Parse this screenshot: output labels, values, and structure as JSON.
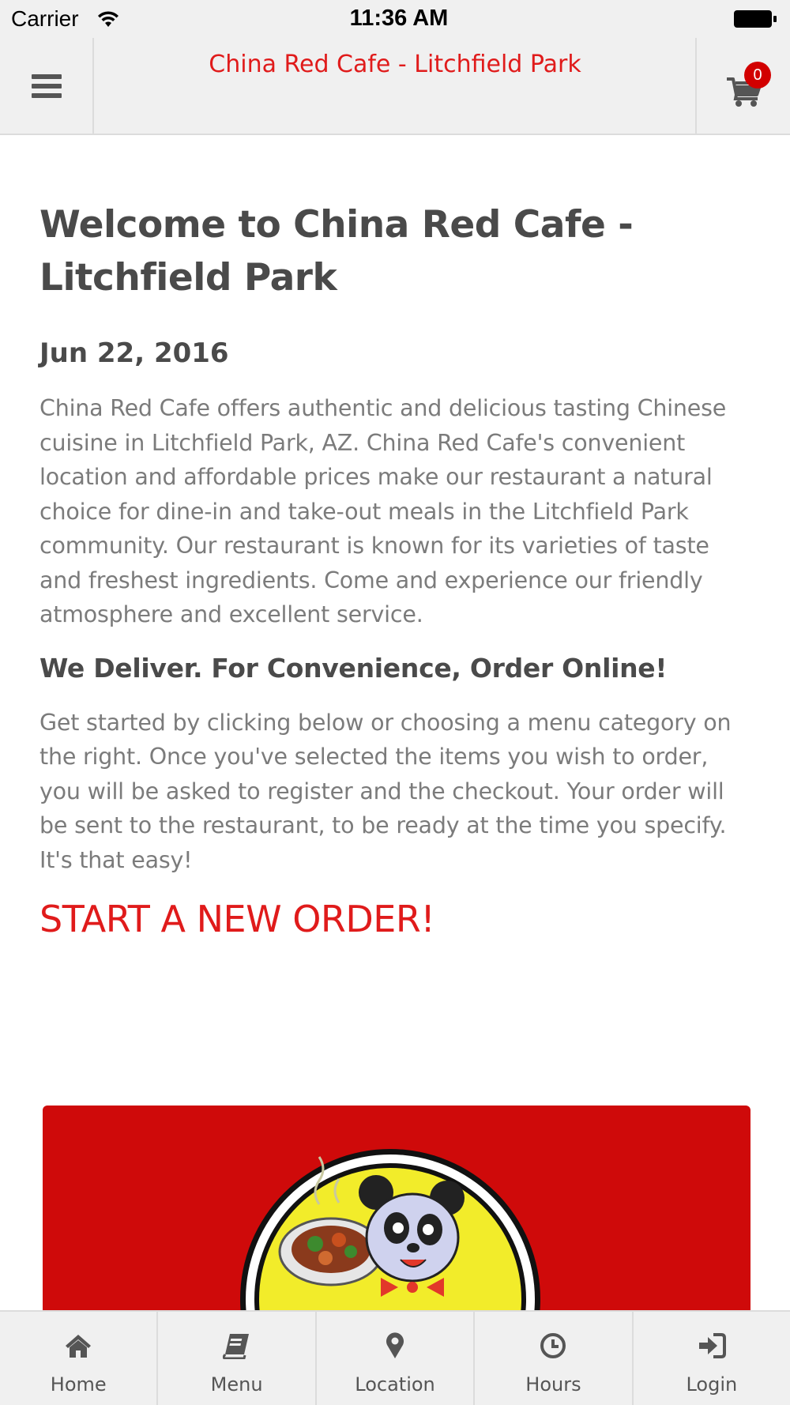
{
  "status_bar": {
    "carrier": "Carrier",
    "time": "11:36 AM"
  },
  "header": {
    "title": "China Red Cafe - Litchfield Park",
    "cart_count": "0",
    "menu_icon": "hamburger-icon",
    "cart_icon": "cart-icon"
  },
  "main": {
    "welcome_title": "Welcome to China Red Cafe - Litchfield Park",
    "date": "Jun 22, 2016",
    "intro": "China Red Cafe offers authentic and delicious tasting Chinese cuisine in Litchfield Park, AZ. China Red Cafe's convenient location and affordable prices make our restaurant a natural choice for dine-in and take-out meals in the Litchfield Park community. Our restaurant is known for its varieties of taste and freshest ingredients. Come and experience our friendly atmosphere and excellent service.",
    "subheading": "We Deliver. For Convenience, Order Online!",
    "instructions": "Get started by clicking below or choosing a menu category on the right. Once you've selected the items you wish to order, you will be asked to register and the checkout. Your order will be sent to the restaurant, to be ready at the time you specify. It's that easy!",
    "cta": "START A NEW ORDER!"
  },
  "tabs": [
    {
      "label": "Home",
      "icon": "home-icon"
    },
    {
      "label": "Menu",
      "icon": "book-icon"
    },
    {
      "label": "Location",
      "icon": "map-pin-icon"
    },
    {
      "label": "Hours",
      "icon": "clock-icon"
    },
    {
      "label": "Login",
      "icon": "sign-in-icon"
    }
  ],
  "colors": {
    "accent": "#e01b1b",
    "banner": "#cf0a0a",
    "bar_background": "#f0f0f0"
  }
}
